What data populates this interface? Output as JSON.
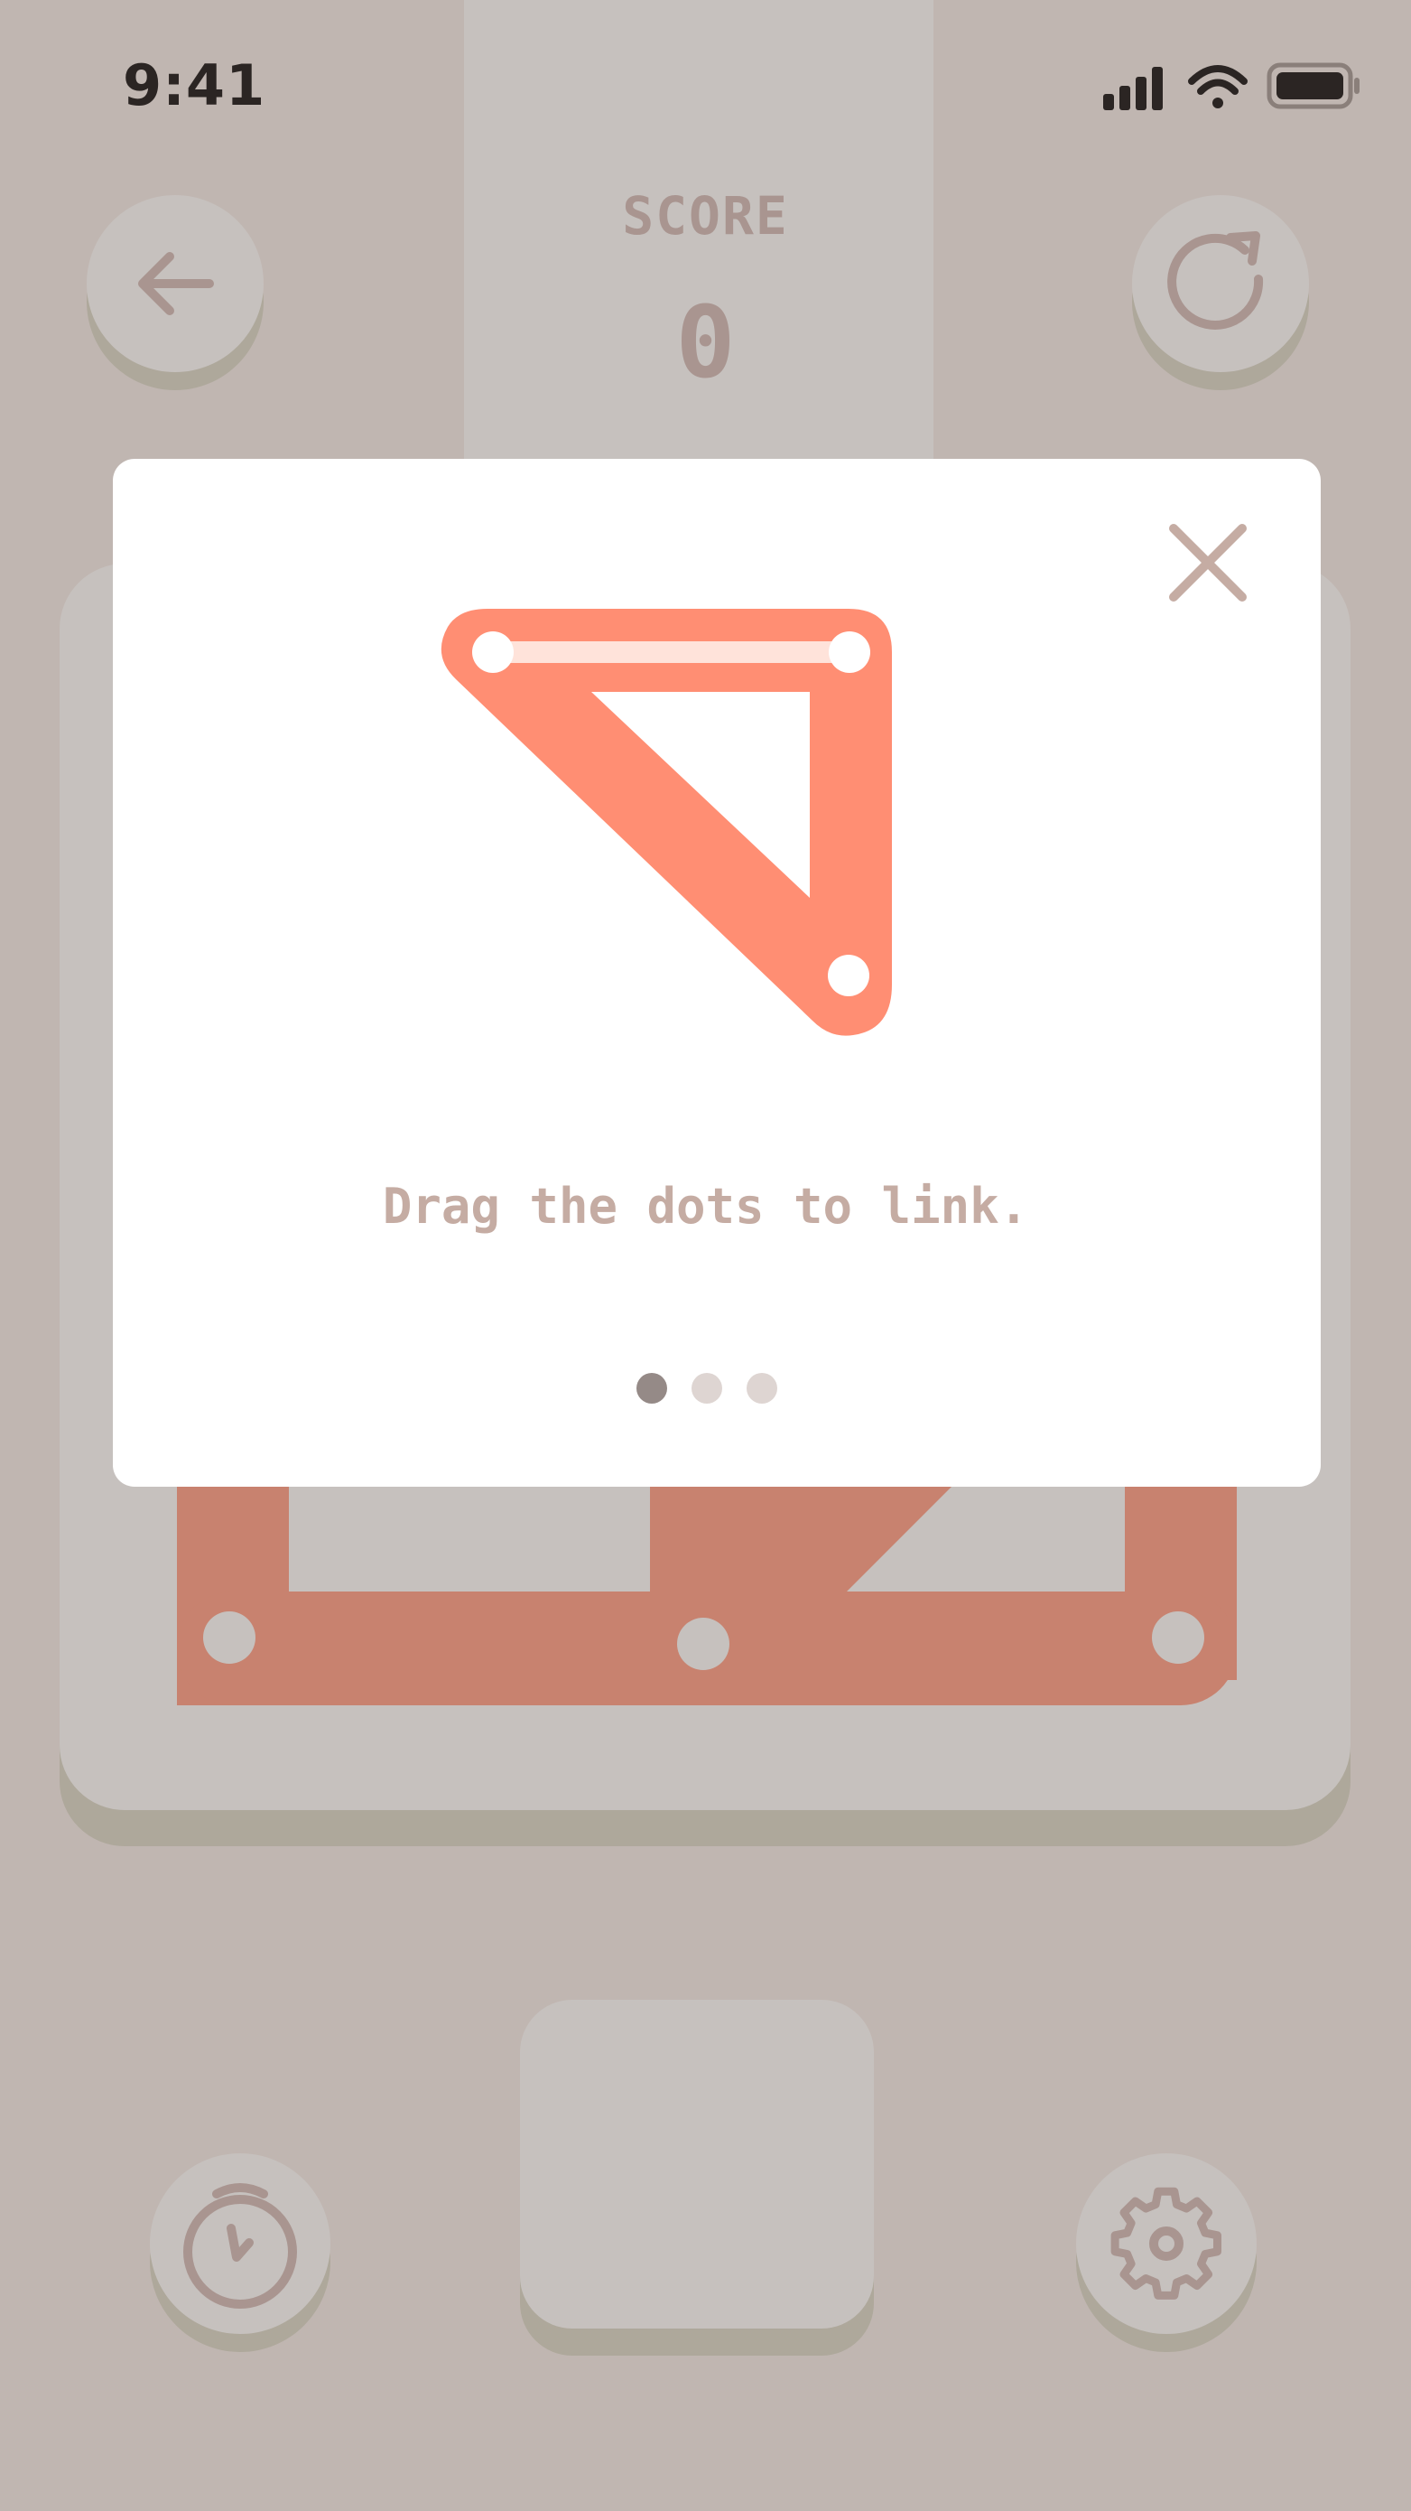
{
  "status_bar": {
    "time": "9:41",
    "icons": [
      "signal-icon",
      "wifi-icon",
      "battery-icon"
    ]
  },
  "header": {
    "score_label": "SCORE",
    "score_value": "0",
    "back_icon": "arrow-left-icon",
    "restart_icon": "restart-icon"
  },
  "tutorial": {
    "message": "Drag the dots to link.",
    "page_count": 3,
    "current_page": 1,
    "close_icon": "close-icon"
  },
  "footer": {
    "timer_icon": "stopwatch-icon",
    "settings_icon": "gear-icon"
  },
  "colors": {
    "background": "#c0b6b1",
    "panel": "#c6c1be",
    "accent": "#ff8e73",
    "board_link": "#c8826f",
    "icon": "#a99590"
  }
}
